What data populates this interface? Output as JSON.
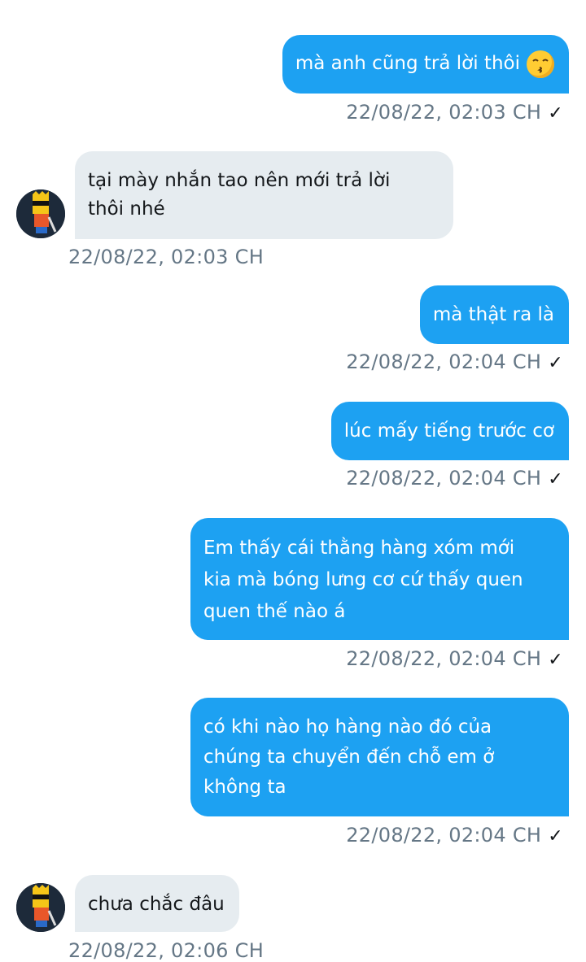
{
  "messages": [
    {
      "dir": "out",
      "text_lines": [
        "mà anh cũng trả lời thôi"
      ],
      "emoji": "kissing-face-icon",
      "meta": "22/08/22,  02:03 CH",
      "read": "✓"
    },
    {
      "dir": "in",
      "text_lines": [
        "tại mày nhắn tao nên mới trả lời",
        "thôi nhé"
      ],
      "meta": "22/08/22,  02:03 CH"
    },
    {
      "dir": "out",
      "text_lines": [
        "mà thật ra là"
      ],
      "meta": "22/08/22,  02:04 CH",
      "read": "✓"
    },
    {
      "dir": "out",
      "text_lines": [
        "lúc mấy tiếng trước cơ"
      ],
      "meta": "22/08/22,  02:04 CH",
      "read": "✓"
    },
    {
      "dir": "out",
      "text_lines": [
        "Em thấy cái thằng hàng xóm mới",
        "kia mà bóng lưng cơ cứ thấy quen",
        "quen thế nào á"
      ],
      "meta": "22/08/22,  02:04 CH",
      "read": "✓"
    },
    {
      "dir": "out",
      "text_lines": [
        "có khi nào họ hàng nào đó của",
        "chúng ta chuyển đến chỗ em ở",
        "không ta"
      ],
      "meta": "22/08/22,  02:04 CH",
      "read": "✓"
    },
    {
      "dir": "in",
      "text_lines": [
        "chưa chắc đâu"
      ],
      "meta": "22/08/22,  02:06 CH"
    }
  ],
  "colors": {
    "outgoing": "#1da1f2",
    "incoming": "#e6ecf0",
    "meta": "#657786"
  },
  "avatar_icon": "cartoon-avatar-icon"
}
